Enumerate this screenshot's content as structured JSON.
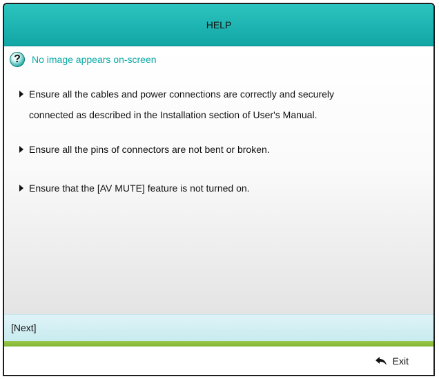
{
  "header": {
    "title": "HELP"
  },
  "question": {
    "icon": "question-icon",
    "text": "No image appears on-screen"
  },
  "bullets": [
    {
      "line1": "Ensure all the cables and power connections are correctly and securely",
      "line2": "connected as described in the Installation section of User's Manual."
    },
    {
      "line1": "Ensure all the pins of connectors are not bent or broken."
    },
    {
      "line1": "Ensure that the [AV MUTE] feature is not turned on."
    }
  ],
  "next": {
    "label": "[Next]"
  },
  "footer": {
    "exit_label": "Exit",
    "exit_icon": "return-arrow-icon"
  },
  "colors": {
    "title_bar": "#1fb3b0",
    "question_text": "#0aa8a6",
    "divider": "#8cbf3a"
  }
}
